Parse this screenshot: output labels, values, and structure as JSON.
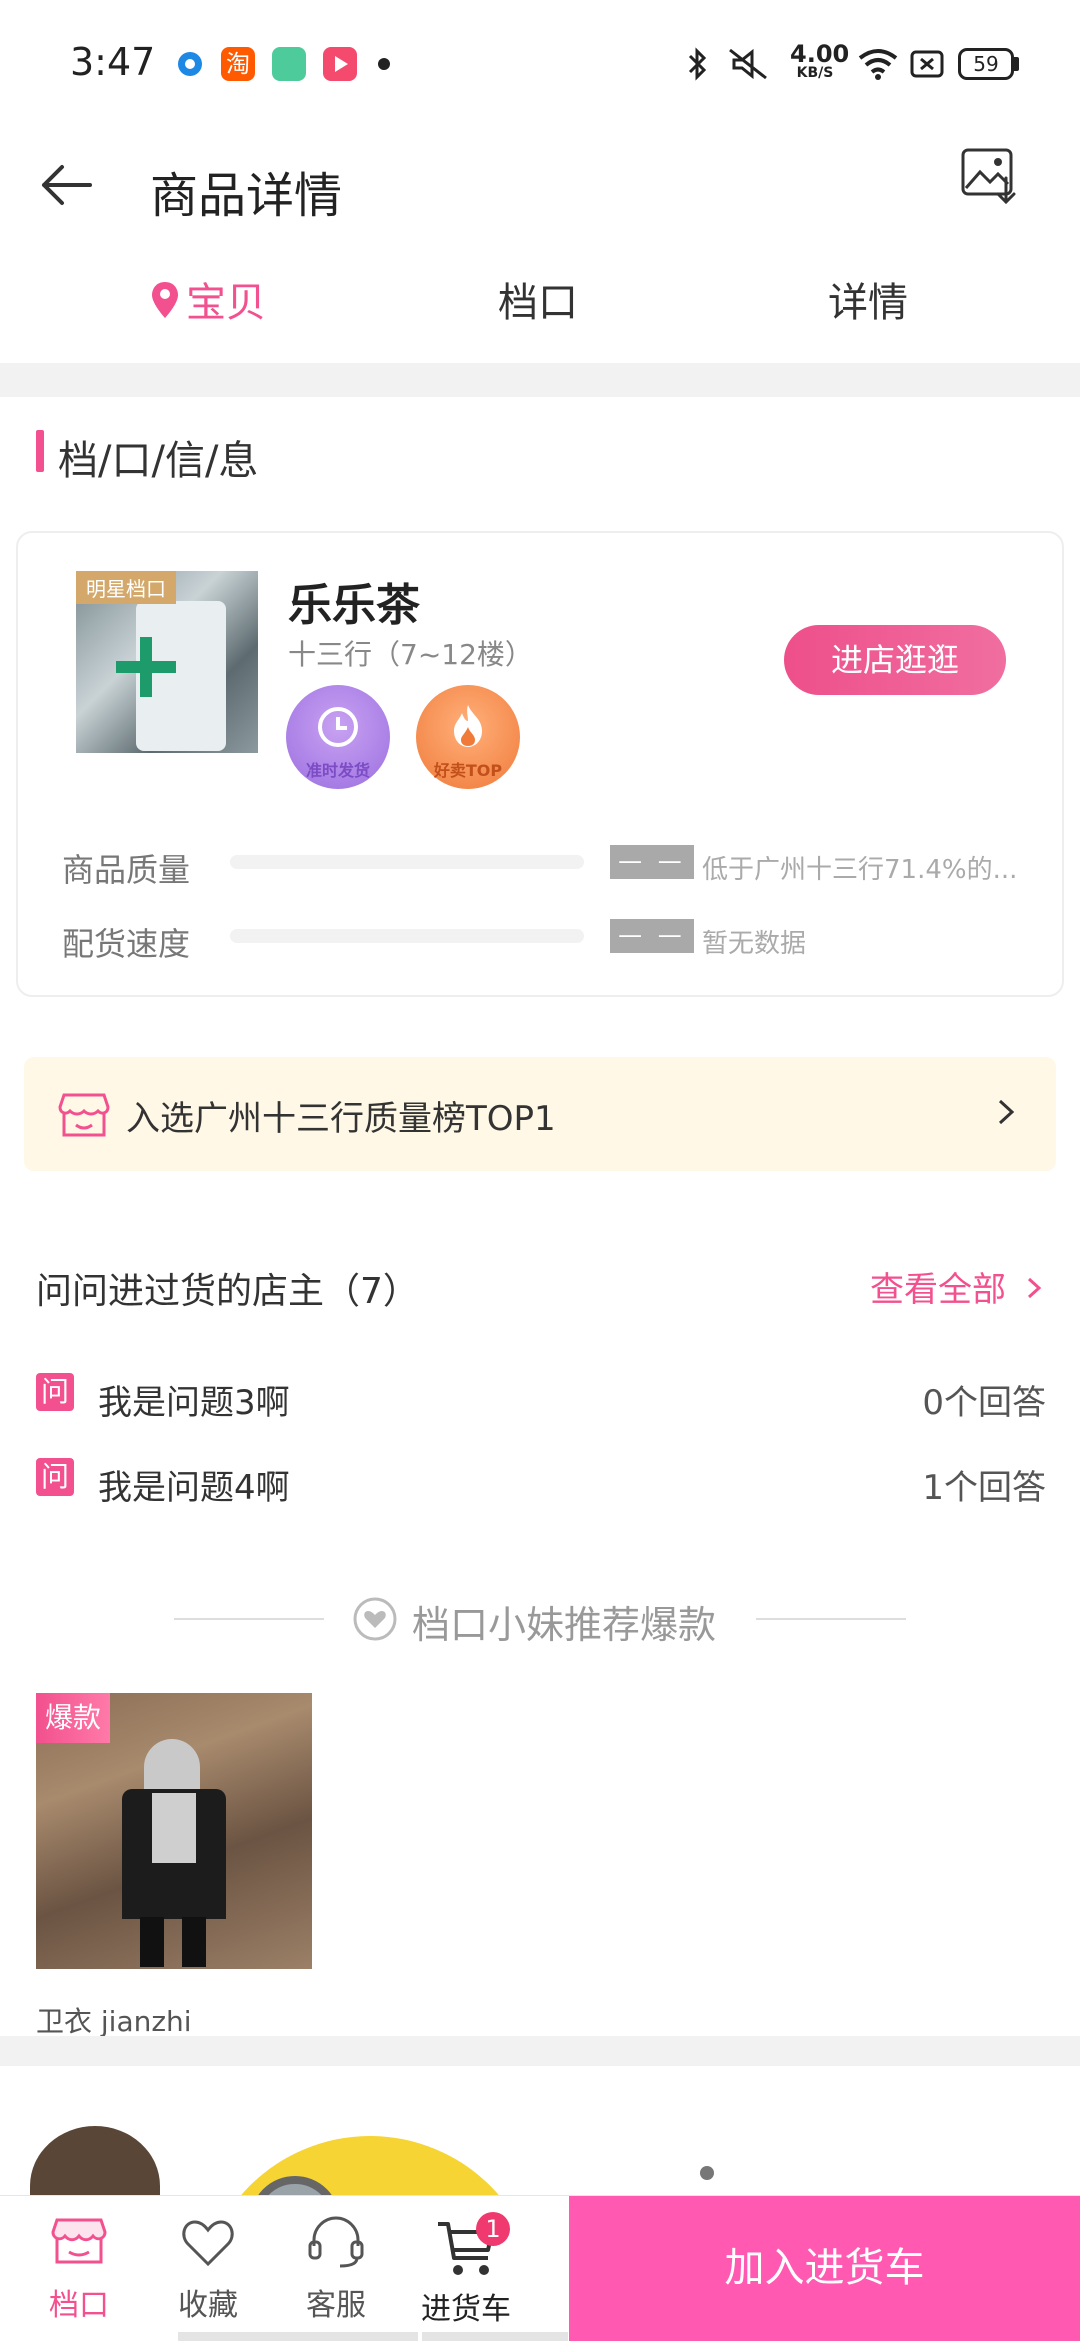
{
  "status_bar": {
    "time": "3:47",
    "net_speed_value": "4.00",
    "net_speed_unit": "KB/S",
    "battery": "59",
    "icons": [
      "app-circle-icon",
      "taobao-icon",
      "app-green-icon",
      "app-play-icon",
      "dot-icon",
      "bluetooth-icon",
      "mute-icon",
      "wifi-icon",
      "sim-icon",
      "battery-icon"
    ],
    "taobao_label": "淘"
  },
  "header": {
    "title": "商品详情",
    "back_icon": "back-arrow-icon",
    "right_icon": "image-download-icon"
  },
  "tabs": {
    "items": [
      {
        "label": "宝贝",
        "active": true
      },
      {
        "label": "档口",
        "active": false
      },
      {
        "label": "详情",
        "active": false
      }
    ],
    "active_color": "#f2508e"
  },
  "section": {
    "title": "档/口/信/息"
  },
  "shop": {
    "badge": "明星档口",
    "name": "乐乐茶",
    "location": "十三行（7~12楼）",
    "visit_button": "进店逛逛",
    "medals": [
      {
        "label": "准时发货",
        "icon": "clock-icon"
      },
      {
        "label": "好卖TOP",
        "icon": "fire-icon"
      }
    ],
    "metrics": [
      {
        "label": "商品质量",
        "score": "— —",
        "note": "低于广州十三行71.4%的..."
      },
      {
        "label": "配货速度",
        "score": "— —",
        "note": "暂无数据"
      }
    ]
  },
  "ranking_banner": {
    "text": "入选广州十三行质量榜TOP1"
  },
  "questions": {
    "title": "问问进过货的店主（7）",
    "view_all": "查看全部",
    "icon_label": "问",
    "items": [
      {
        "text": "我是问题3啊",
        "answers": "0个回答"
      },
      {
        "text": "我是问题4啊",
        "answers": "1个回答"
      }
    ]
  },
  "recommend": {
    "title": "档口小妹推荐爆款",
    "products": [
      {
        "tag": "爆款",
        "name": "卫衣 jianzhi"
      }
    ]
  },
  "bottom_nav": {
    "items": [
      {
        "label": "档口",
        "icon": "shop-icon",
        "active": true
      },
      {
        "label": "收藏",
        "icon": "heart-icon",
        "active": false
      },
      {
        "label": "客服",
        "icon": "headset-icon",
        "active": false
      },
      {
        "label": "进货车",
        "icon": "cart-icon",
        "active": false,
        "badge": "1"
      }
    ],
    "add_to_cart": "加入进货车"
  }
}
